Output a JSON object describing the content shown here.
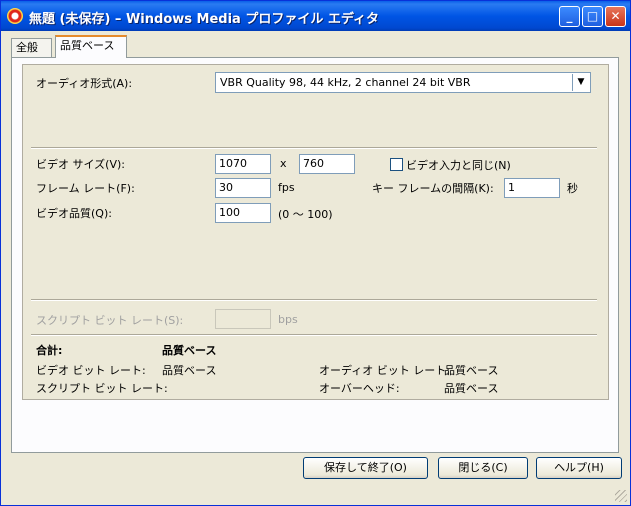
{
  "window": {
    "title": "無題 (未保存) – Windows Media プロファイル エディタ",
    "min_btn": "_",
    "max_btn": "□",
    "close_btn": "✕"
  },
  "tabs": [
    {
      "label": "全般",
      "selected": false
    },
    {
      "label": "品質ベース",
      "selected": true
    }
  ],
  "audio": {
    "format_label": "オーディオ形式(A):",
    "format_value": "VBR Quality 98, 44 kHz, 2 channel 24 bit VBR"
  },
  "video": {
    "size_label": "ビデオ サイズ(V):",
    "width": "1070",
    "x_sep": "x",
    "height": "760",
    "same_as_input_label": "ビデオ入力と同じ(N)",
    "same_as_input_checked": false,
    "framerate_label": "フレーム レート(F):",
    "framerate": "30",
    "fps": "fps",
    "keyframe_label": "キー フレームの間隔(K):",
    "keyframe": "1",
    "sec": "秒",
    "quality_label": "ビデオ品質(Q):",
    "quality": "100",
    "quality_range": "(0 ～ 100)"
  },
  "script": {
    "bitrate_label": "スクリプト ビット レート(S):",
    "bitrate_value": "",
    "unit": "bps"
  },
  "summary": {
    "total_label": "合計:",
    "total_value": "品質ベース",
    "video_bitrate_label": "ビデオ ビット レート:",
    "video_bitrate_value": "品質ベース",
    "script_bitrate_label": "スクリプト ビット レート:",
    "audio_bitrate_label": "オーディオ ビット レート:",
    "audio_bitrate_value": "品質ベース",
    "overhead_label": "オーバーヘッド:",
    "overhead_value": "品質ベース"
  },
  "buttons": {
    "save_close": "保存して終了(O)",
    "close": "閉じる(C)",
    "help": "ヘルプ(H)"
  }
}
